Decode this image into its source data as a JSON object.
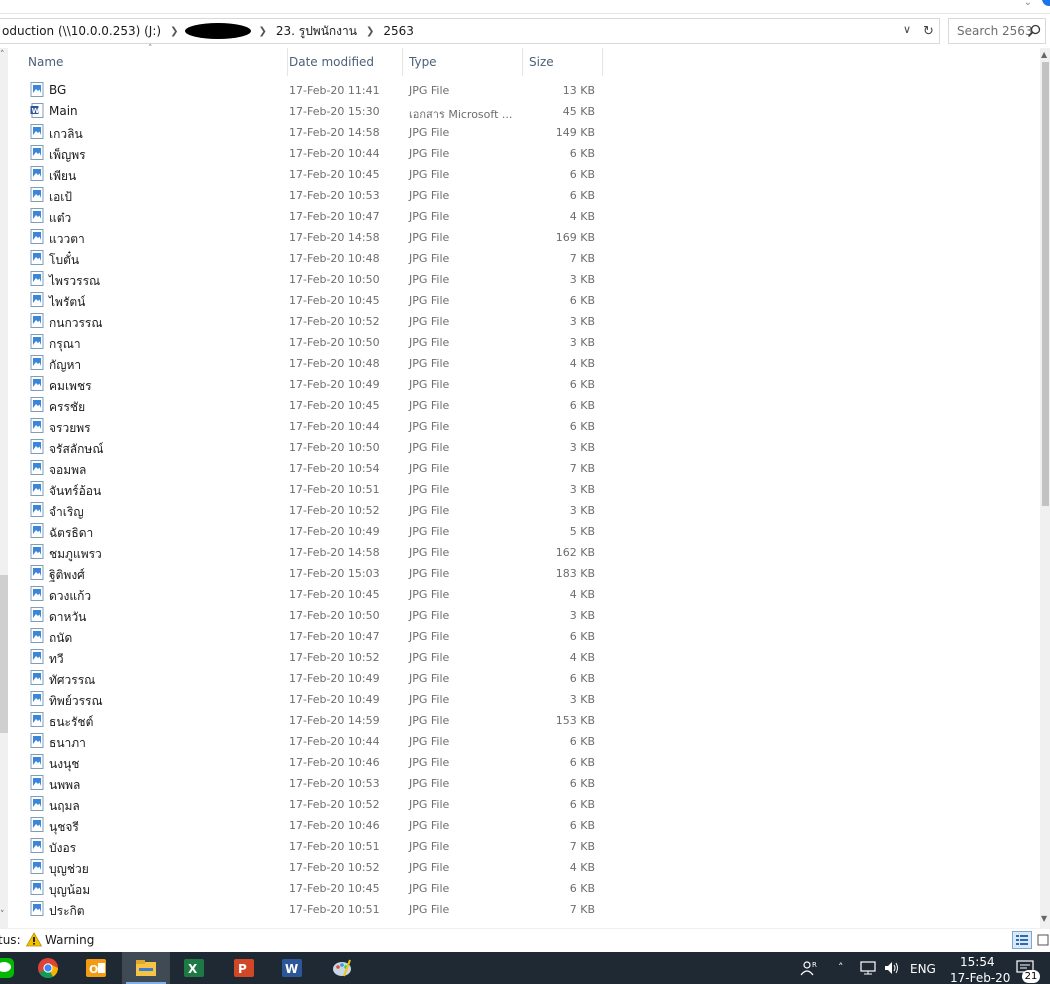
{
  "address": {
    "crumbs": [
      "oduction (\\\\10.0.0.253) (J:)",
      "23. รูปพนักงาน",
      "2563"
    ],
    "search_placeholder": "Search 2563"
  },
  "columns": {
    "name": "Name",
    "date": "Date modified",
    "type": "Type",
    "size": "Size"
  },
  "files": [
    {
      "name": "BG",
      "date": "17-Feb-20 11:41",
      "type": "JPG File",
      "size": "13 KB",
      "icon": "image-file-icon"
    },
    {
      "name": "Main",
      "date": "17-Feb-20 15:30",
      "type": "เอกสาร Microsoft ...",
      "size": "45 KB",
      "icon": "word-doc-icon"
    },
    {
      "name": "เกวลิน",
      "date": "17-Feb-20 14:58",
      "type": "JPG File",
      "size": "149 KB",
      "icon": "image-file-icon"
    },
    {
      "name": "เพ็ญพร",
      "date": "17-Feb-20 10:44",
      "type": "JPG File",
      "size": "6 KB",
      "icon": "image-file-icon"
    },
    {
      "name": "เพียน",
      "date": "17-Feb-20 10:45",
      "type": "JPG File",
      "size": "6 KB",
      "icon": "image-file-icon"
    },
    {
      "name": "เอเป้",
      "date": "17-Feb-20 10:53",
      "type": "JPG File",
      "size": "6 KB",
      "icon": "image-file-icon"
    },
    {
      "name": "แต๋ว",
      "date": "17-Feb-20 10:47",
      "type": "JPG File",
      "size": "4 KB",
      "icon": "image-file-icon"
    },
    {
      "name": "แววตา",
      "date": "17-Feb-20 14:58",
      "type": "JPG File",
      "size": "169 KB",
      "icon": "image-file-icon"
    },
    {
      "name": "โบตั๋น",
      "date": "17-Feb-20 10:48",
      "type": "JPG File",
      "size": "7 KB",
      "icon": "image-file-icon"
    },
    {
      "name": "ไพรวรรณ",
      "date": "17-Feb-20 10:50",
      "type": "JPG File",
      "size": "3 KB",
      "icon": "image-file-icon"
    },
    {
      "name": "ไพรัตน์",
      "date": "17-Feb-20 10:45",
      "type": "JPG File",
      "size": "6 KB",
      "icon": "image-file-icon"
    },
    {
      "name": "กนกวรรณ",
      "date": "17-Feb-20 10:52",
      "type": "JPG File",
      "size": "3 KB",
      "icon": "image-file-icon"
    },
    {
      "name": "กรุณา",
      "date": "17-Feb-20 10:50",
      "type": "JPG File",
      "size": "3 KB",
      "icon": "image-file-icon"
    },
    {
      "name": "กัญหา",
      "date": "17-Feb-20 10:48",
      "type": "JPG File",
      "size": "4 KB",
      "icon": "image-file-icon"
    },
    {
      "name": "คมเพชร",
      "date": "17-Feb-20 10:49",
      "type": "JPG File",
      "size": "6 KB",
      "icon": "image-file-icon"
    },
    {
      "name": "ครรชัย",
      "date": "17-Feb-20 10:45",
      "type": "JPG File",
      "size": "6 KB",
      "icon": "image-file-icon"
    },
    {
      "name": "จรวยพร",
      "date": "17-Feb-20 10:44",
      "type": "JPG File",
      "size": "6 KB",
      "icon": "image-file-icon"
    },
    {
      "name": "จรัสลักษณ์",
      "date": "17-Feb-20 10:50",
      "type": "JPG File",
      "size": "3 KB",
      "icon": "image-file-icon"
    },
    {
      "name": "จอมพล",
      "date": "17-Feb-20 10:54",
      "type": "JPG File",
      "size": "7 KB",
      "icon": "image-file-icon"
    },
    {
      "name": "จันทร์อ้อน",
      "date": "17-Feb-20 10:51",
      "type": "JPG File",
      "size": "3 KB",
      "icon": "image-file-icon"
    },
    {
      "name": "จำเริญ",
      "date": "17-Feb-20 10:52",
      "type": "JPG File",
      "size": "3 KB",
      "icon": "image-file-icon"
    },
    {
      "name": "ฉัตรธิดา",
      "date": "17-Feb-20 10:49",
      "type": "JPG File",
      "size": "5 KB",
      "icon": "image-file-icon"
    },
    {
      "name": "ชมภูแพรว",
      "date": "17-Feb-20 14:58",
      "type": "JPG File",
      "size": "162 KB",
      "icon": "image-file-icon"
    },
    {
      "name": "ฐิติพงศ์",
      "date": "17-Feb-20 15:03",
      "type": "JPG File",
      "size": "183 KB",
      "icon": "image-file-icon"
    },
    {
      "name": "ดวงแก้ว",
      "date": "17-Feb-20 10:45",
      "type": "JPG File",
      "size": "4 KB",
      "icon": "image-file-icon"
    },
    {
      "name": "ดาหวัน",
      "date": "17-Feb-20 10:50",
      "type": "JPG File",
      "size": "3 KB",
      "icon": "image-file-icon"
    },
    {
      "name": "ถนัด",
      "date": "17-Feb-20 10:47",
      "type": "JPG File",
      "size": "6 KB",
      "icon": "image-file-icon"
    },
    {
      "name": "ทวี",
      "date": "17-Feb-20 10:52",
      "type": "JPG File",
      "size": "4 KB",
      "icon": "image-file-icon"
    },
    {
      "name": "ทัศวรรณ",
      "date": "17-Feb-20 10:49",
      "type": "JPG File",
      "size": "6 KB",
      "icon": "image-file-icon"
    },
    {
      "name": "ทิพย์วรรณ",
      "date": "17-Feb-20 10:49",
      "type": "JPG File",
      "size": "3 KB",
      "icon": "image-file-icon"
    },
    {
      "name": "ธนะรัชต์",
      "date": "17-Feb-20 14:59",
      "type": "JPG File",
      "size": "153 KB",
      "icon": "image-file-icon"
    },
    {
      "name": "ธนาภา",
      "date": "17-Feb-20 10:44",
      "type": "JPG File",
      "size": "6 KB",
      "icon": "image-file-icon"
    },
    {
      "name": "นงนุช",
      "date": "17-Feb-20 10:46",
      "type": "JPG File",
      "size": "6 KB",
      "icon": "image-file-icon"
    },
    {
      "name": "นพพล",
      "date": "17-Feb-20 10:53",
      "type": "JPG File",
      "size": "6 KB",
      "icon": "image-file-icon"
    },
    {
      "name": "นฤมล",
      "date": "17-Feb-20 10:52",
      "type": "JPG File",
      "size": "6 KB",
      "icon": "image-file-icon"
    },
    {
      "name": "นุชจรี",
      "date": "17-Feb-20 10:46",
      "type": "JPG File",
      "size": "6 KB",
      "icon": "image-file-icon"
    },
    {
      "name": "บังอร",
      "date": "17-Feb-20 10:51",
      "type": "JPG File",
      "size": "7 KB",
      "icon": "image-file-icon"
    },
    {
      "name": "บุญช่วย",
      "date": "17-Feb-20 10:52",
      "type": "JPG File",
      "size": "4 KB",
      "icon": "image-file-icon"
    },
    {
      "name": "บุญน้อม",
      "date": "17-Feb-20 10:45",
      "type": "JPG File",
      "size": "6 KB",
      "icon": "image-file-icon"
    },
    {
      "name": "ประกิต",
      "date": "17-Feb-20 10:51",
      "type": "JPG File",
      "size": "7 KB",
      "icon": "image-file-icon"
    }
  ],
  "status": {
    "label": "tus:",
    "warning": "Warning"
  },
  "taskbar": {
    "apps": [
      "line-icon",
      "chrome-icon",
      "outlook-icon",
      "file-explorer-icon",
      "excel-icon",
      "powerpoint-icon",
      "word-icon",
      "paint-icon"
    ],
    "active_app": "file-explorer-icon",
    "language": "ENG",
    "time": "15:54",
    "date": "17-Feb-20",
    "notifications": "21"
  },
  "colors": {
    "taskbar_bg": "#1f2933",
    "header_text": "#4c607a",
    "warning": "#f2c200",
    "accent": "#1a73e8"
  }
}
